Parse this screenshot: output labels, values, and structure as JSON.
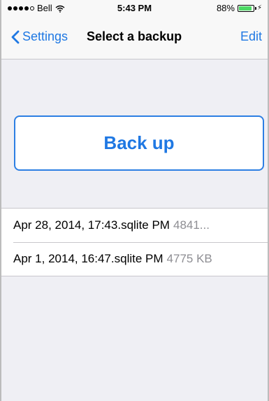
{
  "status_bar": {
    "carrier": "Bell",
    "time": "5:43 PM",
    "battery_percent": "88%",
    "battery_level": 0.88,
    "battery_color": "#4cd964"
  },
  "navbar": {
    "back_label": "Settings",
    "title": "Select a backup",
    "edit_label": "Edit"
  },
  "backup_button": {
    "label": "Back up"
  },
  "backups": [
    {
      "name": "Apr 28, 2014, 17:43.sqlite PM",
      "size": "4841..."
    },
    {
      "name": "Apr 1, 2014, 16:47.sqlite PM",
      "size": "4775 KB"
    }
  ],
  "colors": {
    "accent": "#1f78e3",
    "background": "#efeff4",
    "secondary_text": "#8e8e93"
  }
}
